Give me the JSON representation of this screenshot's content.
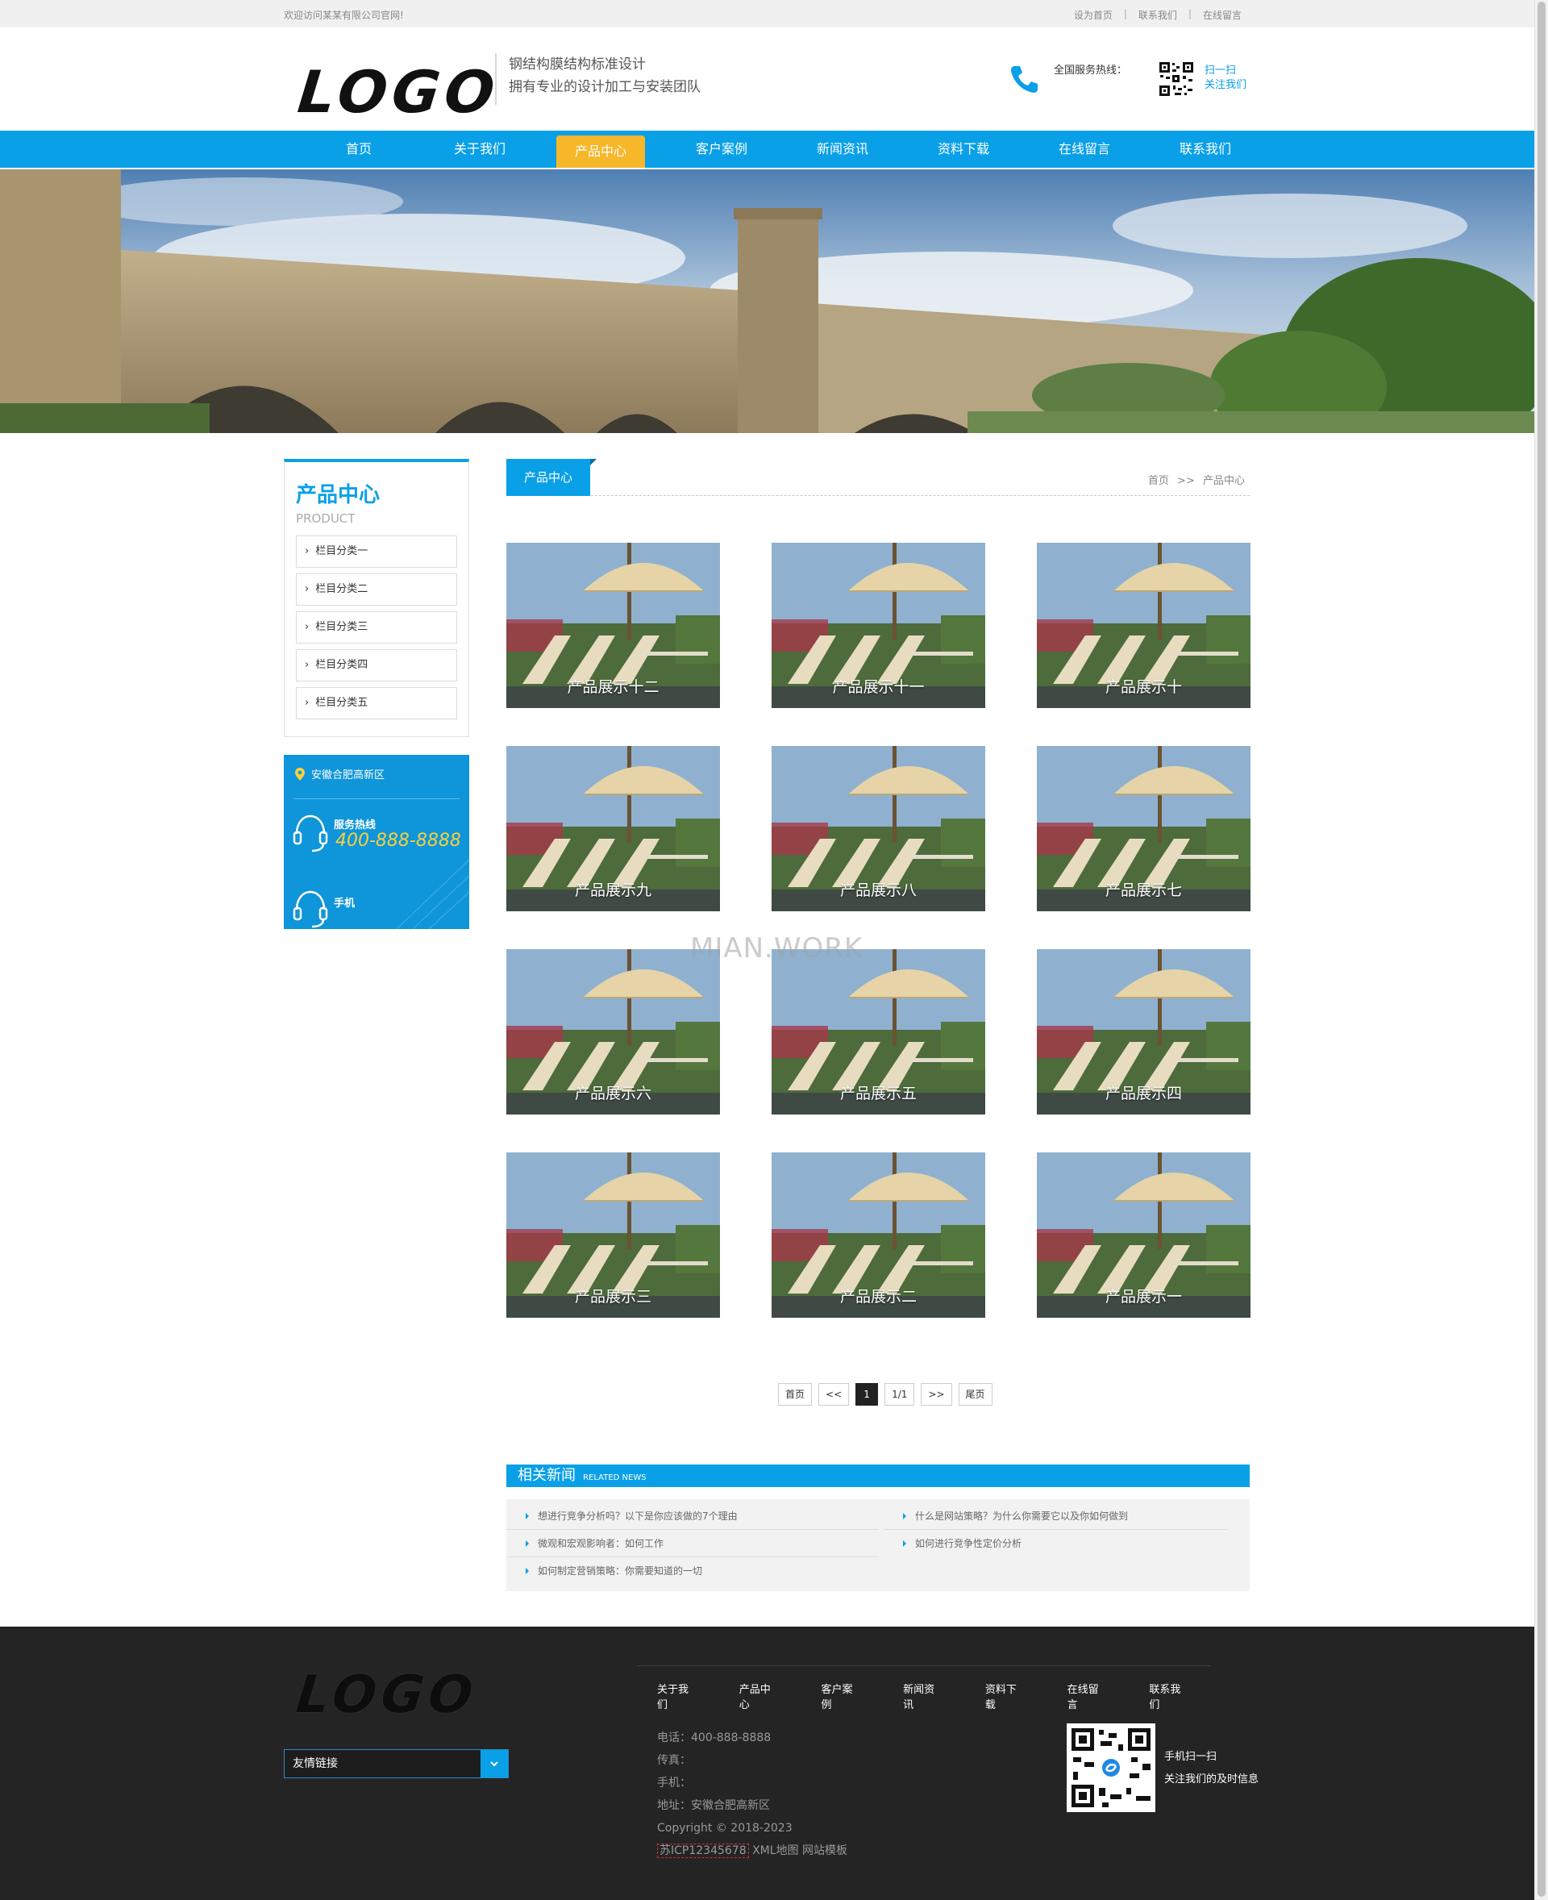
{
  "topbar": {
    "welcome": "欢迎访问某某有限公司官网!",
    "links": [
      "设为首页",
      "联系我们",
      "在线留言"
    ]
  },
  "header": {
    "logo": "LOGO",
    "slogan_line1": "钢结构膜结构标准设计",
    "slogan_line2": "拥有专业的设计加工与安装团队",
    "hotline_label": "全国服务热线：",
    "scan_line1": "扫一扫",
    "scan_line2": "关注我们"
  },
  "nav": {
    "items": [
      "首页",
      "关于我们",
      "产品中心",
      "客户案例",
      "新闻资讯",
      "资料下载",
      "在线留言",
      "联系我们"
    ],
    "active_index": 2
  },
  "sidebar": {
    "title": "产品中心",
    "subtitle": "PRODUCT",
    "categories": [
      "栏目分类一",
      "栏目分类二",
      "栏目分类三",
      "栏目分类四",
      "栏目分类五"
    ],
    "contact": {
      "address": "安徽合肥高新区",
      "hotline_label": "服务热线",
      "hotline_number": "400-888-8888",
      "mobile_label": "手机"
    }
  },
  "content": {
    "section_title": "产品中心",
    "breadcrumb_home": "首页",
    "breadcrumb_sep": ">>",
    "breadcrumb_current": "产品中心",
    "products": [
      "产品展示十二",
      "产品展示十一",
      "产品展示十",
      "产品展示九",
      "产品展示八",
      "产品展示七",
      "产品展示六",
      "产品展示五",
      "产品展示四",
      "产品展示三",
      "产品展示二",
      "产品展示一"
    ],
    "watermark": "MIAN.WORK"
  },
  "pager": {
    "first": "首页",
    "prev": "<<",
    "current": "1",
    "count": "1/1",
    "next": ">>",
    "last": "尾页"
  },
  "news": {
    "title": "相关新闻",
    "title_en": "RELATED NEWS",
    "items": [
      "想进行竞争分析吗？以下是你应该做的7个理由",
      "什么是网站策略？为什么你需要它以及你如何做到",
      "微观和宏观影响者：如何工作",
      "如何进行竞争性定价分析",
      "如何制定营销策略：你需要知道的一切"
    ]
  },
  "footer": {
    "logo": "LOGO",
    "friend_links": "友情链接",
    "nav": [
      "关于我们",
      "产品中心",
      "客户案例",
      "新闻资讯",
      "资料下载",
      "在线留言",
      "联系我们"
    ],
    "phone": "电话：400-888-8888",
    "fax": "传真：",
    "mobile": "手机：",
    "address": "地址：安徽合肥高新区",
    "copyright": "Copyright © 2018-2023",
    "icp": "苏ICP12345678",
    "xml": "XML地图",
    "template": "网站模板",
    "qr_line1": "手机扫一扫",
    "qr_line2": "关注我们的及时信息"
  },
  "colors": {
    "primary": "#0aa0e8",
    "accent": "#f7b72b",
    "footer_bg": "#242424",
    "hotline_number": "#f7d13b"
  }
}
